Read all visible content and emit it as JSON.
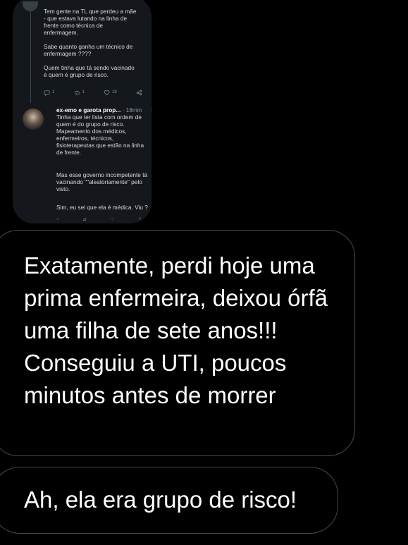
{
  "embedded_screenshot": {
    "tweet_1": {
      "text": "Tem gente na TL que perdeu a mãe\n- que estava lutando na linha de\nfrente como técnica de\nenfermagem.\n\nSabe quanto ganha um técnico de\nenfermagem ????\n\nQuem tinha que tá sendo vacinado\né quem é grupo de risco.",
      "reply_count": "1",
      "retweet_count": "1",
      "like_count": "19"
    },
    "tweet_2": {
      "author_name": "ex-emo e garota prop...",
      "time": "· 18min",
      "more": "⋮",
      "text_1": "Tinha que ter lista com ordem de\nquem é do grupo de risco.\nMapeamento dos médicos,\nenfermeiros, técnicos,\nfisioterapeutas que estão na linha\nde frente.",
      "text_2": "Mas esse governo incompetente tá\nvacinando \"\"aleatoriamente\" pelo\nvisto.",
      "text_3": "Sim, eu sei que ela é médica. Viu ?"
    }
  },
  "messages": [
    {
      "text": "Exatamente, perdi hoje uma prima enfermeira, deixou órfã uma filha de sete anos!!! Conseguiu a UTI, poucos minutos antes de morrer"
    },
    {
      "text": "Ah, ela era grupo de risco!"
    }
  ],
  "colors": {
    "background": "#000000",
    "bubble_border": "#4a4a4a",
    "embedded_background": "#14171c",
    "secondary_text": "#8899a6"
  }
}
